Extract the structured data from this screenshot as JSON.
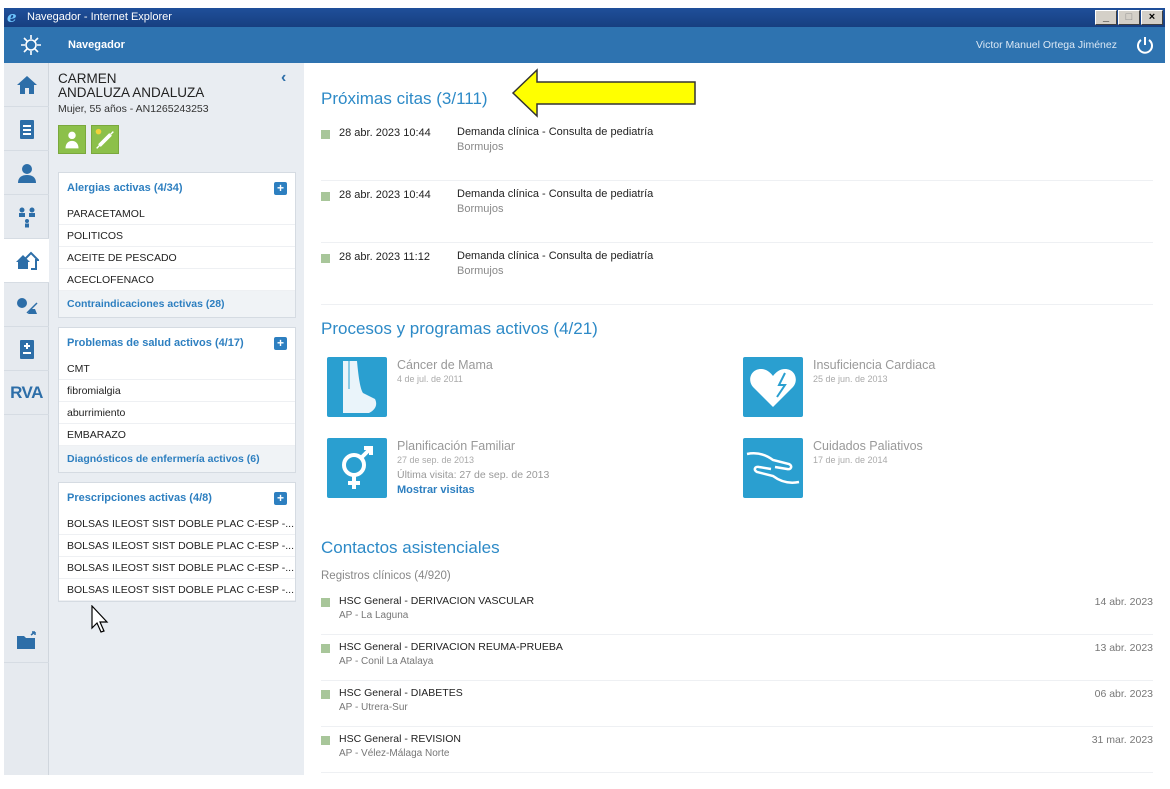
{
  "window": {
    "title": "Navegador - Internet Explorer",
    "minimize": "_",
    "maximize": "□",
    "close": "×"
  },
  "header": {
    "app_name": "Navegador",
    "user_name": "Victor Manuel Ortega Jiménez"
  },
  "rail": {
    "rva_label": "RVA"
  },
  "patient": {
    "first_name": "CARMEN",
    "last_name": "ANDALUZA ANDALUZA",
    "meta": "Mujer, 55 años - AN1265243253",
    "collapse_glyph": "‹"
  },
  "allergies": {
    "title": "Alergias activas (4/34)",
    "items": [
      "PARACETAMOL",
      "POLITICOS",
      "ACEITE DE PESCADO",
      "ACECLOFENACO"
    ],
    "footer": "Contraindicaciones activas (28)"
  },
  "problems": {
    "title": "Problemas de salud activos (4/17)",
    "items": [
      "CMT",
      "fibromialgia",
      "aburrimiento",
      "EMBARAZO"
    ],
    "footer": "Diagnósticos de enfermería activos (6)"
  },
  "prescriptions": {
    "title": "Prescripciones activas (4/8)",
    "items": [
      "BOLSAS ILEOST SIST DOBLE PLAC C-ESP -...",
      "BOLSAS ILEOST SIST DOBLE PLAC C-ESP -...",
      "BOLSAS ILEOST SIST DOBLE PLAC C-ESP -...",
      "BOLSAS ILEOST SIST DOBLE PLAC C-ESP -..."
    ]
  },
  "plus_glyph": "+",
  "appointments": {
    "title": "Próximas citas (3/111)",
    "items": [
      {
        "date": "28 abr. 2023 10:44",
        "desc": "Demanda clínica - Consulta de pediatría",
        "loc": "Bormujos"
      },
      {
        "date": "28 abr. 2023 10:44",
        "desc": "Demanda clínica - Consulta de pediatría",
        "loc": "Bormujos"
      },
      {
        "date": "28 abr. 2023 11:12",
        "desc": "Demanda clínica - Consulta de pediatría",
        "loc": "Bormujos"
      }
    ]
  },
  "processes": {
    "title": "Procesos y programas activos (4/21)",
    "items": [
      {
        "name": "Cáncer de Mama",
        "date": "4 de jul. de 2011",
        "icon": "breast-icon"
      },
      {
        "name": "Insuficiencia Cardiaca",
        "date": "25 de jun. de 2013",
        "icon": "heart-icon"
      },
      {
        "name": "Planificación Familiar",
        "date": "27 de sep. de 2013",
        "last_visit": "Última visita: 27 de sep. de 2013",
        "link": "Mostrar visitas",
        "icon": "gender-icon"
      },
      {
        "name": "Cuidados Paliativos",
        "date": "17 de jun. de 2014",
        "icon": "hands-icon"
      }
    ]
  },
  "contacts": {
    "title": "Contactos asistenciales",
    "subtitle": "Registros clínicos (4/920)",
    "items": [
      {
        "title": "HSC General - DERIVACION VASCULAR",
        "sub": "AP - La Laguna",
        "date": "14 abr. 2023"
      },
      {
        "title": "HSC General - DERIVACION REUMA-PRUEBA",
        "sub": "AP - Conil La Atalaya",
        "date": "13 abr. 2023"
      },
      {
        "title": "HSC General - DIABETES",
        "sub": "AP - Utrera-Sur",
        "date": "06 abr. 2023"
      },
      {
        "title": "HSC General - REVISION",
        "sub": "AP - Vélez-Málaga Norte",
        "date": "31 mar. 2023"
      }
    ]
  },
  "colors": {
    "accent": "#2d8ac7",
    "header": "#2e73b0",
    "badge": "#8cc04a",
    "annotation_arrow": "#ffff00"
  }
}
